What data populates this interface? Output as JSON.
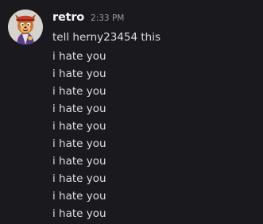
{
  "message": {
    "avatar_icon": "cartoon-character-avatar-icon",
    "username": "retro",
    "timestamp": "2:33 PM",
    "lines": [
      "tell herny23454 this",
      "i hate you",
      "i hate you",
      "i hate you",
      "i hate you",
      "i hate you",
      "i hate you",
      "i hate you",
      "i hate you",
      "i hate you",
      "i hate you"
    ]
  },
  "colors": {
    "background": "#1a1a1e",
    "username": "#f2f3f5",
    "timestamp": "#949ba4",
    "text": "#dbdee1"
  }
}
